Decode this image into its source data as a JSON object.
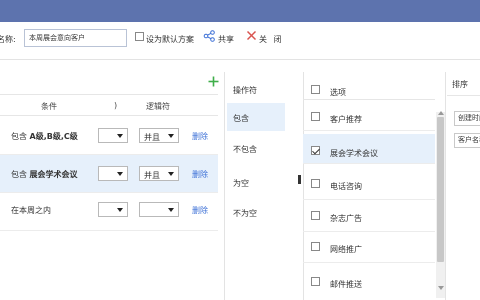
{
  "toolbar": {
    "name_label": "名称:",
    "name_value": "本周展会意向客户",
    "default_label": "设为默认方案",
    "share_label": "共享",
    "close_label": "关 闭"
  },
  "conditions": {
    "headers": {
      "condition": "条件",
      "paren": ")",
      "logic": "逻辑符"
    },
    "rows": [
      {
        "prefix": "包含 ",
        "value": "A级,B级,C级",
        "paren": "",
        "logic": "并且",
        "delete": "删除",
        "selected": false
      },
      {
        "prefix": "包含 ",
        "value": "展会学术会议",
        "paren": "",
        "logic": "并且",
        "delete": "删除",
        "selected": true
      },
      {
        "prefix": "在本周之内",
        "value": "",
        "paren": "",
        "logic": "",
        "delete": "删除",
        "selected": false
      }
    ]
  },
  "operators": {
    "title": "操作符",
    "items": [
      "包含",
      "不包含",
      "为空",
      "不为空"
    ],
    "selected_index": 0
  },
  "options": {
    "header": "选项",
    "items": [
      {
        "label": "客户推荐",
        "checked": false
      },
      {
        "label": "展会学术会议",
        "checked": true
      },
      {
        "label": "电话咨询",
        "checked": false
      },
      {
        "label": "杂志广告",
        "checked": false
      },
      {
        "label": "网络推广",
        "checked": false
      },
      {
        "label": "邮件推送",
        "checked": false
      }
    ]
  },
  "sort": {
    "title": "排序",
    "items": [
      "创建时间",
      "客户名称"
    ]
  },
  "colors": {
    "titlebar": "#5d73ae",
    "selected_row": "#e6f0fb",
    "link": "#3b6fd6",
    "add_icon": "#3fae49"
  }
}
